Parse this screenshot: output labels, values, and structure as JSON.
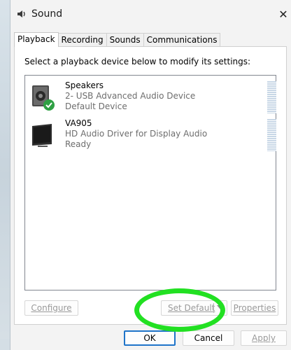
{
  "window": {
    "title": "Sound"
  },
  "tabs": [
    {
      "label": "Playback",
      "active": true
    },
    {
      "label": "Recording",
      "active": false
    },
    {
      "label": "Sounds",
      "active": false
    },
    {
      "label": "Communications",
      "active": false
    }
  ],
  "playback": {
    "instruction": "Select a playback device below to modify its settings:",
    "devices": [
      {
        "name": "Speakers",
        "line1": "2- USB Advanced Audio Device",
        "line2": "Default Device",
        "icon": "speaker-icon",
        "is_default": true
      },
      {
        "name": "VA905",
        "line1": "HD Audio Driver for Display Audio",
        "line2": "Ready",
        "icon": "monitor-icon",
        "is_default": false
      }
    ]
  },
  "buttons": {
    "configure": "Configure",
    "set_default": "Set Default",
    "properties": "Properties",
    "ok": "OK",
    "cancel": "Cancel",
    "apply": "Apply"
  },
  "colors": {
    "highlight": "#22e022",
    "default_check": "#2ea043",
    "ok_border": "#1f74c9"
  }
}
